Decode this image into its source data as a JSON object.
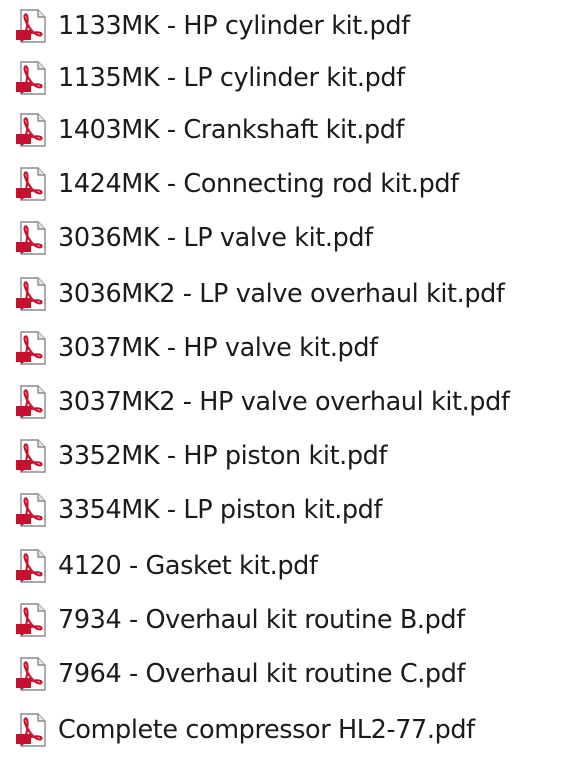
{
  "files": [
    {
      "name": "1133MK - HP cylinder kit.pdf",
      "icon": "pdf-file-icon"
    },
    {
      "name": "1135MK - LP cylinder kit.pdf",
      "icon": "pdf-file-icon"
    },
    {
      "name": "1403MK - Crankshaft kit.pdf",
      "icon": "pdf-file-icon"
    },
    {
      "name": "1424MK - Connecting rod kit.pdf",
      "icon": "pdf-file-icon"
    },
    {
      "name": "3036MK - LP valve kit.pdf",
      "icon": "pdf-file-icon"
    },
    {
      "name": "3036MK2 - LP valve overhaul kit.pdf",
      "icon": "pdf-file-icon"
    },
    {
      "name": "3037MK - HP valve kit.pdf",
      "icon": "pdf-file-icon"
    },
    {
      "name": "3037MK2 - HP valve overhaul kit.pdf",
      "icon": "pdf-file-icon"
    },
    {
      "name": "3352MK - HP piston kit.pdf",
      "icon": "pdf-file-icon"
    },
    {
      "name": "3354MK - LP piston kit.pdf",
      "icon": "pdf-file-icon"
    },
    {
      "name": "4120 - Gasket kit.pdf",
      "icon": "pdf-file-icon"
    },
    {
      "name": "7934 - Overhaul kit routine B.pdf",
      "icon": "pdf-file-icon"
    },
    {
      "name": "7964 - Overhaul kit routine C.pdf",
      "icon": "pdf-file-icon"
    },
    {
      "name": "Complete compressor HL2-77.pdf",
      "icon": "pdf-file-icon"
    }
  ],
  "colors": {
    "icon_red": "#c8102e",
    "icon_page": "#ffffff",
    "text": "#1b1b1b"
  }
}
